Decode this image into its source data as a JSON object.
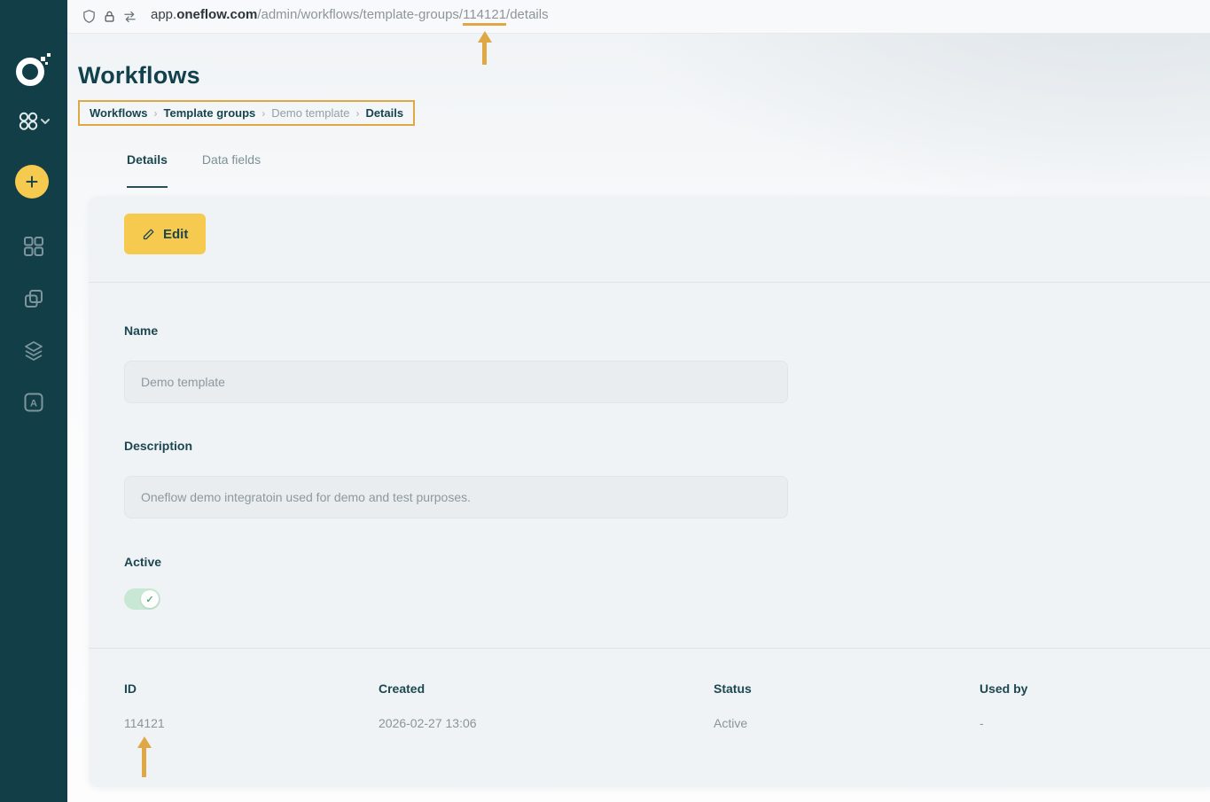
{
  "colors": {
    "annotation_gold": "#dfa844",
    "accent_yellow": "#f6c94f",
    "sidebar_bg": "#123e48",
    "toggle_green": "#c9e7d5"
  },
  "browser": {
    "url": {
      "subdomain": "app.",
      "domain": "oneflow.com",
      "path_before_id": "/admin/workflows/template-groups/",
      "id": "114121",
      "path_after_id": "/details"
    }
  },
  "sidebar": {
    "plus_glyph": "+",
    "letter_a": "A",
    "icons": [
      "oneflow-logo",
      "workspace-switcher-icon",
      "add-button",
      "apps-grid-icon",
      "copy-templates-icon",
      "layers-icon",
      "letter-a-icon"
    ]
  },
  "header": {
    "title": "Workflows",
    "breadcrumb_separator": "›",
    "breadcrumb": [
      {
        "label": "Workflows"
      },
      {
        "label": "Template groups"
      },
      {
        "label": "Demo template"
      },
      {
        "label": "Details"
      }
    ]
  },
  "tabs": [
    {
      "label": "Details",
      "active": true
    },
    {
      "label": "Data fields",
      "active": false
    }
  ],
  "card": {
    "edit_button_label": "Edit",
    "name_label": "Name",
    "name_value": "Demo template",
    "description_label": "Description",
    "description_value": "Oneflow demo integratoin used for demo and test purposes.",
    "active_label": "Active",
    "toggle": {
      "state": "on",
      "check_glyph": "✓"
    },
    "meta": {
      "headers": [
        "ID",
        "Created",
        "Status",
        "Used by"
      ],
      "values": [
        "114121",
        "2026-02-27 13:06",
        "Active",
        "-"
      ]
    }
  }
}
